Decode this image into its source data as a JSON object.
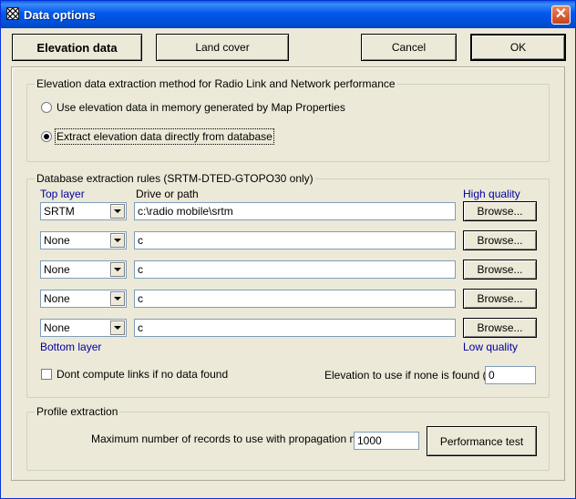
{
  "window": {
    "title": "Data options",
    "close_symbol": "✕"
  },
  "toolbar": {
    "elevation_label": "Elevation data",
    "landcover_label": "Land cover",
    "cancel_label": "Cancel",
    "ok_label": "OK"
  },
  "method": {
    "title": "Elevation data extraction method for Radio Link and Network performance",
    "option_memory": "Use elevation data in memory generated by Map Properties",
    "option_database": "Extract elevation data directly from database",
    "selected": "database"
  },
  "rules": {
    "title": "Database extraction rules (SRTM-DTED-GTOPO30 only)",
    "top_layer": "Top layer",
    "drive_path": "Drive or path",
    "high_quality": "High quality",
    "bottom_layer": "Bottom layer",
    "low_quality": "Low quality",
    "browse_label": "Browse...",
    "layers": [
      {
        "type": "SRTM",
        "path": "c:\\radio mobile\\srtm"
      },
      {
        "type": "None",
        "path": "c"
      },
      {
        "type": "None",
        "path": "c"
      },
      {
        "type": "None",
        "path": "c"
      },
      {
        "type": "None",
        "path": "c"
      }
    ],
    "dont_compute_label": "Dont compute links if no data found",
    "dont_compute_checked": false,
    "elevation_none_label": "Elevation to use if none is found (m)",
    "elevation_none_value": "0"
  },
  "profile": {
    "title": "Profile extraction",
    "max_records_label": "Maximum number of records to use with propagation model",
    "max_records_value": "1000",
    "performance_label": "Performance test"
  }
}
